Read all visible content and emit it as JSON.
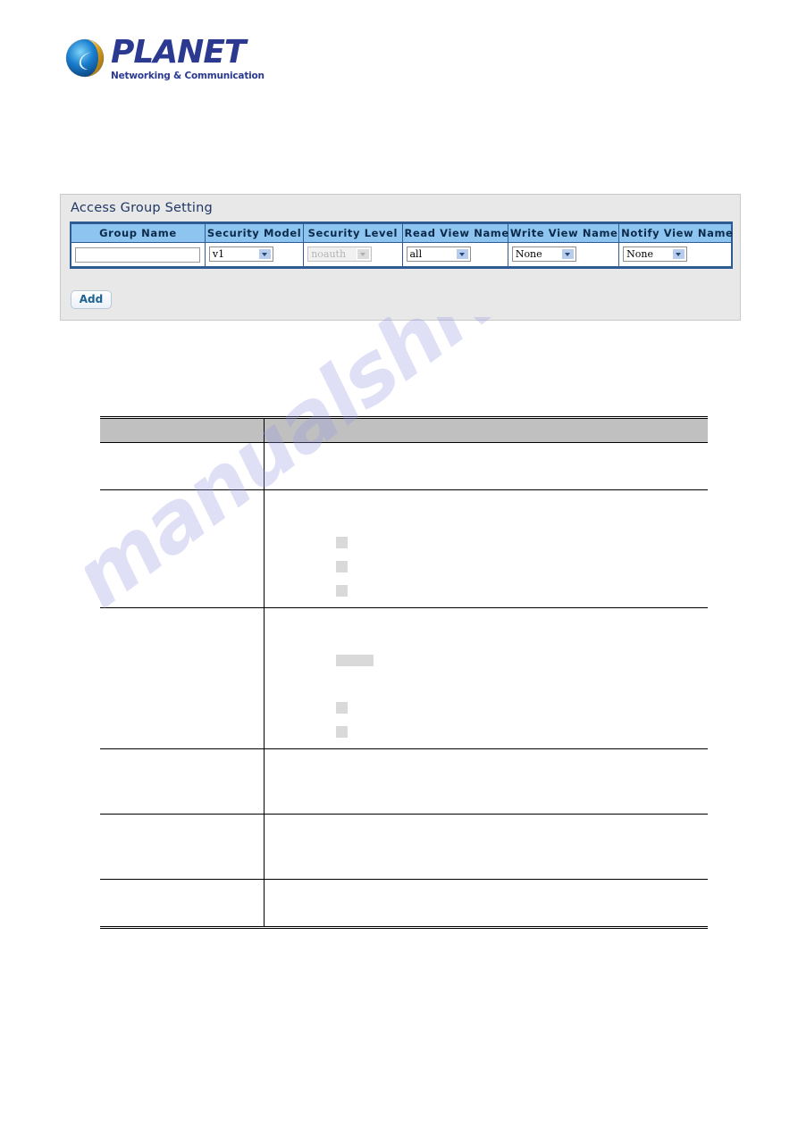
{
  "brand": {
    "name": "PLANET",
    "tagline": "Networking & Communication",
    "logo_icon": "planet-globe-logo",
    "text_color": "#2b3990"
  },
  "watermark": {
    "text": "manualshive.com",
    "color": "#9696e1"
  },
  "panel": {
    "title": "Access Group Setting",
    "title_color": "#1f3864",
    "header_bg": "#8ec4f0",
    "border_color": "#2e5b91",
    "columns": [
      "Group Name",
      "Security Model",
      "Security Level",
      "Read View Name",
      "Write View Name",
      "Notify View Name"
    ],
    "row": {
      "group_name_value": "",
      "group_name_placeholder": "",
      "security_model_value": "v1",
      "security_level_value": "noauth",
      "security_level_disabled": true,
      "read_view_value": "all",
      "write_view_value": "None",
      "notify_view_value": "None"
    },
    "add_label": "Add"
  },
  "description_table": {
    "header_bg": "#c0c0c0",
    "columns": [
      "",
      ""
    ],
    "rows": [
      {
        "label": "",
        "value": ""
      },
      {
        "label": "",
        "value": ""
      },
      {
        "label": "",
        "value": ""
      },
      {
        "label": "",
        "value": ""
      },
      {
        "label": "",
        "value": ""
      },
      {
        "label": "",
        "value": ""
      }
    ]
  }
}
